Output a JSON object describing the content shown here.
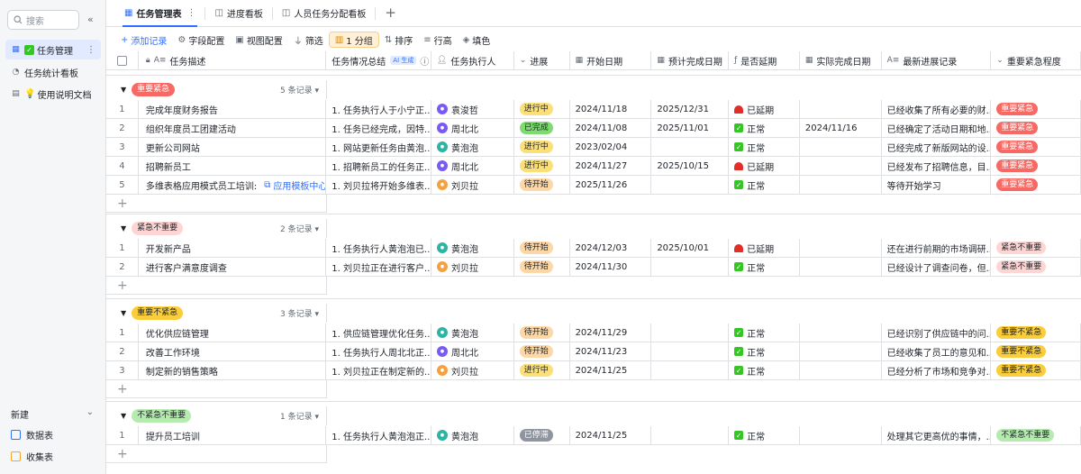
{
  "sidebar": {
    "search_placeholder": "搜索",
    "collapse_glyph": "«",
    "items": [
      {
        "label": "任务管理",
        "active": true
      },
      {
        "label": "任务统计看板",
        "active": false
      },
      {
        "label": "使用说明文档",
        "active": false
      }
    ],
    "new_label": "新建",
    "bottom": [
      {
        "label": "数据表"
      },
      {
        "label": "收集表"
      }
    ]
  },
  "tabs": [
    {
      "label": "任务管理表",
      "active": true
    },
    {
      "label": "进度看板",
      "active": false
    },
    {
      "label": "人员任务分配看板",
      "active": false
    }
  ],
  "toolbar": {
    "add": "添加记录",
    "field": "字段配置",
    "view": "视图配置",
    "filter": "筛选",
    "group": "1 分组",
    "sort": "排序",
    "rowheight": "行高",
    "fill": "填色"
  },
  "headers": [
    "任务描述",
    "任务情况总结",
    "任务执行人",
    "进展",
    "开始日期",
    "预计完成日期",
    "是否延期",
    "实际完成日期",
    "最新进展记录",
    "重要紧急程度"
  ],
  "ai_tag": "AI 生成",
  "groups": [
    {
      "label": "重要紧急",
      "count": "5 条记录",
      "bg": "#f76964",
      "fg": "#ffffff",
      "rows": [
        {
          "n": "1",
          "desc": "完成年度财务报告",
          "sum": "1. 任务执行人于小宁正...",
          "person": "袁浚哲",
          "pcolor": "#7a5af5",
          "prog": "进行中",
          "start": "2024/11/18",
          "plan": "2025/12/31",
          "delay": "已延期",
          "actual": "",
          "latest": "已经收集了所有必要的财...",
          "prio": "重要紧急"
        },
        {
          "n": "2",
          "desc": "组织年度员工团建活动",
          "sum": "1. 任务已经完成，因特...",
          "person": "周北北",
          "pcolor": "#7a5af5",
          "prog": "已完成",
          "start": "2024/11/08",
          "plan": "2025/11/01",
          "delay": "正常",
          "actual": "2024/11/16",
          "latest": "已经确定了活动日期和地...",
          "prio": "重要紧急"
        },
        {
          "n": "3",
          "desc": "更新公司网站",
          "sum": "1. 网站更新任务由黄泡...",
          "person": "黄泡泡",
          "pcolor": "#2db4a5",
          "prog": "进行中",
          "start": "2023/02/04",
          "plan": "",
          "delay": "正常",
          "actual": "",
          "latest": "已经完成了新版网站的设...",
          "prio": "重要紧急"
        },
        {
          "n": "4",
          "desc": "招聘新员工",
          "sum": "1. 招聘新员工的任务正...",
          "person": "周北北",
          "pcolor": "#7a5af5",
          "prog": "进行中",
          "start": "2024/11/27",
          "plan": "2025/10/15",
          "delay": "已延期",
          "actual": "",
          "latest": "已经发布了招聘信息，目...",
          "prio": "重要紧急"
        },
        {
          "n": "5",
          "desc": "多维表格应用模式员工培训:",
          "link": "应用模板中心",
          "sum": "1. 刘贝拉将开始多维表...",
          "person": "刘贝拉",
          "pcolor": "#f5a142",
          "prog": "待开始",
          "start": "2025/11/26",
          "plan": "",
          "delay": "正常",
          "actual": "",
          "latest": "等待开始学习",
          "prio": "重要紧急"
        }
      ]
    },
    {
      "label": "紧急不重要",
      "count": "2 条记录",
      "bg": "#fdd6d4",
      "fg": "#1f2329",
      "rows": [
        {
          "n": "1",
          "desc": "开发新产品",
          "sum": "1. 任务执行人黄泡泡已...",
          "person": "黄泡泡",
          "pcolor": "#2db4a5",
          "prog": "待开始",
          "start": "2024/12/03",
          "plan": "2025/10/01",
          "delay": "已延期",
          "actual": "",
          "latest": "还在进行前期的市场调研...",
          "prio": "紧急不重要"
        },
        {
          "n": "2",
          "desc": "进行客户满意度调查",
          "sum": "1. 刘贝拉正在进行客户...",
          "person": "刘贝拉",
          "pcolor": "#f5a142",
          "prog": "待开始",
          "start": "2024/11/30",
          "plan": "",
          "delay": "正常",
          "actual": "",
          "latest": "已经设计了调查问卷，但...",
          "prio": "紧急不重要"
        }
      ]
    },
    {
      "label": "重要不紧急",
      "count": "3 条记录",
      "bg": "#f9cd3b",
      "fg": "#1f2329",
      "rows": [
        {
          "n": "1",
          "desc": "优化供应链管理",
          "sum": "1. 供应链管理优化任务...",
          "person": "黄泡泡",
          "pcolor": "#2db4a5",
          "prog": "待开始",
          "start": "2024/11/29",
          "plan": "",
          "delay": "正常",
          "actual": "",
          "latest": "已经识别了供应链中的问...",
          "prio": "重要不紧急"
        },
        {
          "n": "2",
          "desc": "改善工作环境",
          "sum": "1. 任务执行人周北北正...",
          "person": "周北北",
          "pcolor": "#7a5af5",
          "prog": "待开始",
          "start": "2024/11/23",
          "plan": "",
          "delay": "正常",
          "actual": "",
          "latest": "已经收集了员工的意见和...",
          "prio": "重要不紧急"
        },
        {
          "n": "3",
          "desc": "制定新的销售策略",
          "sum": "1. 刘贝拉正在制定新的...",
          "person": "刘贝拉",
          "pcolor": "#f5a142",
          "prog": "进行中",
          "start": "2024/11/25",
          "plan": "",
          "delay": "正常",
          "actual": "",
          "latest": "已经分析了市场和竞争对...",
          "prio": "重要不紧急"
        }
      ]
    },
    {
      "label": "不紧急不重要",
      "count": "1 条记录",
      "bg": "#b6ebb0",
      "fg": "#1f2329",
      "rows": [
        {
          "n": "1",
          "desc": "提升员工培训",
          "sum": "1. 任务执行人黄泡泡正...",
          "person": "黄泡泡",
          "pcolor": "#2db4a5",
          "prog": "已停滞",
          "start": "2024/11/25",
          "plan": "",
          "delay": "正常",
          "actual": "",
          "latest": "处理其它更高优的事情，...",
          "prio": "不紧急不重要"
        }
      ]
    }
  ],
  "progress_colors": {
    "进行中": {
      "bg": "#fbe07a",
      "fg": "#1f2329"
    },
    "已完成": {
      "bg": "#7ddb70",
      "fg": "#1f2329"
    },
    "待开始": {
      "bg": "#fdd8a6",
      "fg": "#1f2329"
    },
    "已停滞": {
      "bg": "#8f959e",
      "fg": "#ffffff"
    }
  }
}
